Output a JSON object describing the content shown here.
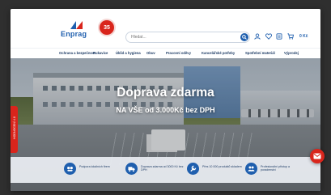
{
  "header": {
    "logo_text": "Enprag",
    "badge_text": "35",
    "search": {
      "placeholder": "Hledat..."
    },
    "cart_price": "0 Kč"
  },
  "nav": {
    "items": [
      "Ochrana a bezpečnost",
      "Rukavice",
      "Úklid a hygiena",
      "Obuv",
      "Pracovní oděvy",
      "Kancelářské potřeby",
      "Spotřební materiál",
      "Výprodej"
    ]
  },
  "hero": {
    "title": "Doprava zdarma",
    "subtitle": "NA VŠE od 3.000Kč bez DPH"
  },
  "sidetab": {
    "label": "HODNOCENÍ 4.8"
  },
  "features": [
    {
      "icon": "delivery-icon",
      "text": "Podpora lokálních firem"
    },
    {
      "icon": "truck-icon",
      "text": "Doprava zdarma od 3000 Kč bez DPH"
    },
    {
      "icon": "tools-icon",
      "text": "Přes 10 000 produktů skladem"
    },
    {
      "icon": "people-icon",
      "text": "Profesionální přístup a poradenství"
    }
  ],
  "colors": {
    "brand_blue": "#1f5fae",
    "brand_red": "#d9251c"
  }
}
